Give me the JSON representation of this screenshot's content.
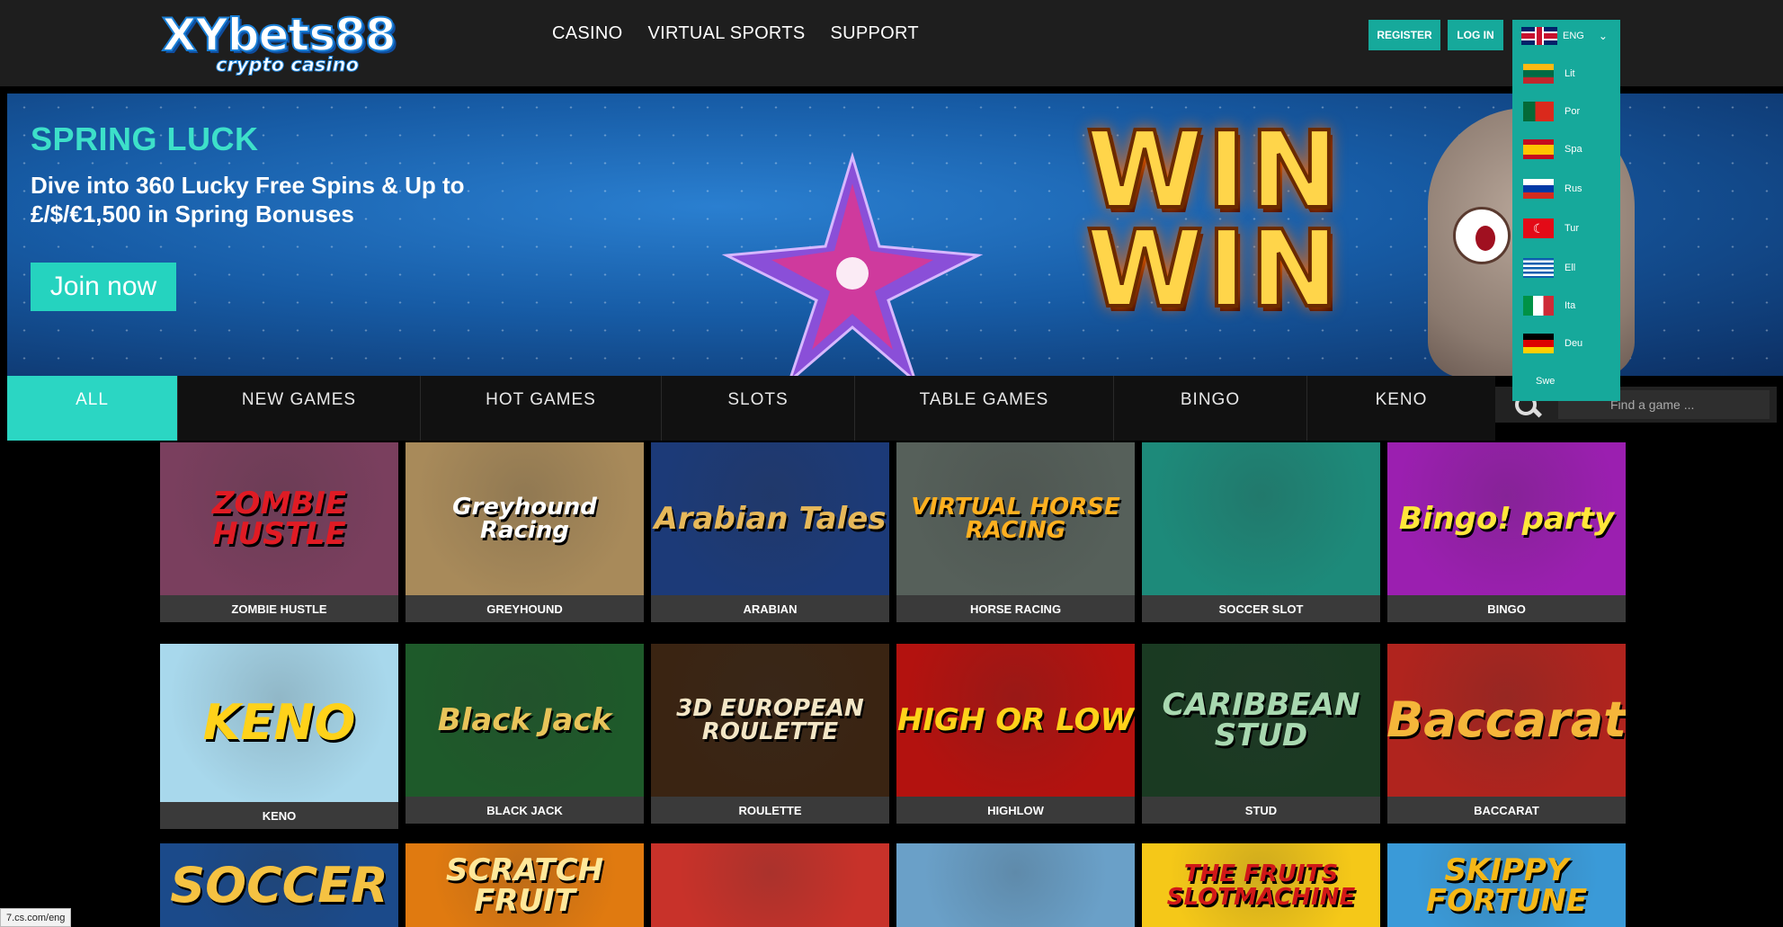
{
  "logo": {
    "main": "XYbets88",
    "sub": "crypto casino"
  },
  "nav": [
    {
      "label": "CASINO"
    },
    {
      "label": "VIRTUAL SPORTS"
    },
    {
      "label": "SUPPORT"
    }
  ],
  "auth": {
    "register": "REGISTER",
    "login": "LOG IN"
  },
  "language": {
    "selected": "ENG",
    "options": [
      "Lit",
      "Por",
      "Spa",
      "Rus",
      "Tur",
      "Ell",
      "Ita",
      "Deu",
      "Swe"
    ]
  },
  "banner": {
    "title": "SPRING LUCK",
    "text": "Dive into 360 Lucky Free Spins & Up to £/$/€1,500 in Spring Bonuses",
    "cta": "Join now",
    "art_text": "WIN WIN"
  },
  "tabs": [
    "ALL",
    "NEW GAMES",
    "HOT GAMES",
    "SLOTS",
    "TABLE GAMES",
    "BINGO",
    "KENO"
  ],
  "search": {
    "placeholder": "Find a game ..."
  },
  "games": [
    {
      "label": "ZOMBIE HUSTLE",
      "art": "ZOMBIE HUSTLE",
      "bg": "#7a3f5e",
      "fg": "#e01b24"
    },
    {
      "label": "GREYHOUND",
      "art": "Greyhound Racing",
      "bg": "#a88a5a",
      "fg": "#ffffff"
    },
    {
      "label": "ARABIAN",
      "art": "Arabian Tales",
      "bg": "#1c3a78",
      "fg": "#e6b85a"
    },
    {
      "label": "HORSE RACING",
      "art": "VIRTUAL HORSE RACING",
      "bg": "#56605a",
      "fg": "#ffb020"
    },
    {
      "label": "SOCCER SLOT",
      "art": "",
      "bg": "#1d8a7a",
      "fg": "#ffffff"
    },
    {
      "label": "BINGO",
      "art": "Bingo! party",
      "bg": "#9b1fb0",
      "fg": "#ffe63a"
    },
    {
      "label": "KENO",
      "art": "KENO",
      "bg": "#a8d8ec",
      "fg": "#ffd21a"
    },
    {
      "label": "BLACK JACK",
      "art": "Black Jack",
      "bg": "#1e5a2a",
      "fg": "#e8c45a"
    },
    {
      "label": "ROULETTE",
      "art": "3D EUROPEAN ROULETTE",
      "bg": "#3a2412",
      "fg": "#f3e6c6"
    },
    {
      "label": "HIGHLOW",
      "art": "HIGH OR LOW",
      "bg": "#b3120f",
      "fg": "#ffd21a"
    },
    {
      "label": "STUD",
      "art": "CARIBBEAN STUD",
      "bg": "#1a3a22",
      "fg": "#a8d8b0"
    },
    {
      "label": "BACCARAT",
      "art": "Baccarat",
      "bg": "#b0241e",
      "fg": "#f5b63a"
    },
    {
      "label": "",
      "art": "SOCCER",
      "bg": "#1b4a8a",
      "fg": "#f5c242"
    },
    {
      "label": "",
      "art": "SCRATCH FRUIT",
      "bg": "#e07a10",
      "fg": "#ffe89a"
    },
    {
      "label": "",
      "art": "",
      "bg": "#c8322a",
      "fg": "#ffffff"
    },
    {
      "label": "",
      "art": "",
      "bg": "#6aa0c8",
      "fg": "#ffffff"
    },
    {
      "label": "",
      "art": "THE FRUITS SLOTMACHINE",
      "bg": "#f5c818",
      "fg": "#d01818"
    },
    {
      "label": "",
      "art": "SKIPPY FORTUNE",
      "bg": "#3a9ad8",
      "fg": "#f5b818"
    }
  ],
  "status_url": "7.cs.com/eng"
}
